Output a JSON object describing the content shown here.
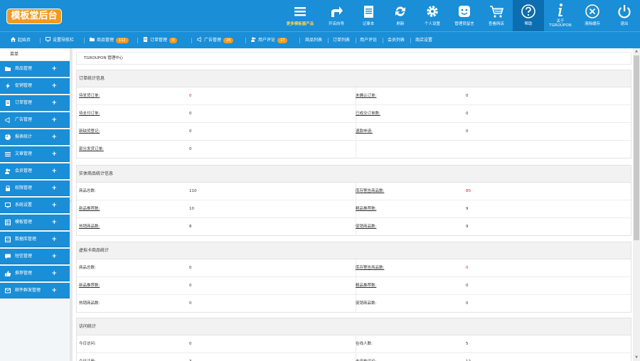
{
  "brand": {
    "logo": "模板堂后台"
  },
  "header_buttons": [
    {
      "label": "更多模板屋产品",
      "icon": "menu-icon"
    },
    {
      "label": "开店向导",
      "icon": "share-arrow-icon"
    },
    {
      "label": "记事本",
      "icon": "notepad-icon"
    },
    {
      "label": "刷新",
      "icon": "refresh-icon"
    },
    {
      "label": "个人设置",
      "icon": "gear-icon"
    },
    {
      "label": "管理员留言",
      "icon": "smiley-icon"
    },
    {
      "label": "查看网店",
      "icon": "cart-icon"
    },
    {
      "label": "帮助",
      "icon": "help-icon"
    },
    {
      "label": "关于 TGROUPON",
      "icon": "info-icon"
    },
    {
      "label": "清除缓存",
      "icon": "close-circle-icon"
    },
    {
      "label": "退出",
      "icon": "power-icon"
    }
  ],
  "nav": {
    "home": "起始页",
    "wizard": "设置导航栏",
    "goods": "商品管理",
    "goods_count": "112",
    "orders": "订单管理",
    "orders_count": "0",
    "ads": "广告管理",
    "ads_count": "26",
    "reviews": "用户评论",
    "reviews_count": "37",
    "goods_list": "商品列表",
    "order_list": "订单列表",
    "user_reviews": "用户评论",
    "member_list": "会员列表",
    "store_settings": "商店设置"
  },
  "sidebar": {
    "heading": "菜单",
    "items": [
      {
        "label": "商品管理",
        "icon": "folder-icon"
      },
      {
        "label": "促销管理",
        "icon": "bolt-icon"
      },
      {
        "label": "订单管理",
        "icon": "document-icon"
      },
      {
        "label": "广告管理",
        "icon": "megaphone-icon"
      },
      {
        "label": "报表统计",
        "icon": "pie-icon"
      },
      {
        "label": "文章管理",
        "icon": "list-icon"
      },
      {
        "label": "会员管理",
        "icon": "users-icon"
      },
      {
        "label": "权限管理",
        "icon": "lock-icon"
      },
      {
        "label": "系统设置",
        "icon": "monitor-icon"
      },
      {
        "label": "模板管理",
        "icon": "grid-icon"
      },
      {
        "label": "数据库管理",
        "icon": "database-icon"
      },
      {
        "label": "短信管理",
        "icon": "message-icon"
      },
      {
        "label": "推荐管理",
        "icon": "thumbs-up-icon"
      },
      {
        "label": "邮件群发管理",
        "icon": "envelope-icon"
      }
    ]
  },
  "main": {
    "breadcrumb": "TGROUPON 管理中心",
    "panels": [
      {
        "title": "订单统计信息",
        "rows": [
          {
            "l1": "待发货订单:",
            "v1": "0",
            "v1_red": true,
            "l2": "未确认订单:",
            "v2": "0"
          },
          {
            "l1": "待支付订单:",
            "v1": "0",
            "l2": "已成交订单数:",
            "v2": "0"
          },
          {
            "l1": "新缺货登记:",
            "v1": "0",
            "l2": "退款申请:",
            "v2": "0"
          },
          {
            "l1": "部分发货订单:",
            "v1": "0",
            "l2": "",
            "v2": ""
          }
        ]
      },
      {
        "title": "实体商品统计信息",
        "rows": [
          {
            "l1": "商品总数:",
            "v1": "110",
            "l2": "库存警告商品数:",
            "v2": "80",
            "v2_red": true
          },
          {
            "l1": "新品推荐数:",
            "v1": "10",
            "l2": "精品推荐数:",
            "v2": "9"
          },
          {
            "l1": "热销商品数:",
            "v1": "8",
            "l2": "促销商品数:",
            "v2": "9"
          }
        ]
      },
      {
        "title": "虚拟卡商品统计",
        "rows": [
          {
            "l1": "商品总数:",
            "v1": "0",
            "l2": "库存警告商品数:",
            "v2": "0",
            "v2_red": true
          },
          {
            "l1": "新品推荐数:",
            "v1": "0",
            "l2": "精品推荐数:",
            "v2": "0"
          },
          {
            "l1": "热销商品数:",
            "v1": "0",
            "l2": "促销商品数:",
            "v2": "0"
          }
        ]
      },
      {
        "title": "访问统计",
        "rows": [
          {
            "l1": "今日访问:",
            "v1": "0",
            "l2": "在线人数:",
            "v2": "5"
          },
          {
            "l1": "今日注册:",
            "v1": "3",
            "l2": "未审核评论:",
            "v2": "12"
          }
        ]
      }
    ]
  },
  "colors": {
    "header": "#1a8ed6",
    "logo": "#f39a1e",
    "badge": "#f39a1e",
    "alert": "#e02020"
  }
}
